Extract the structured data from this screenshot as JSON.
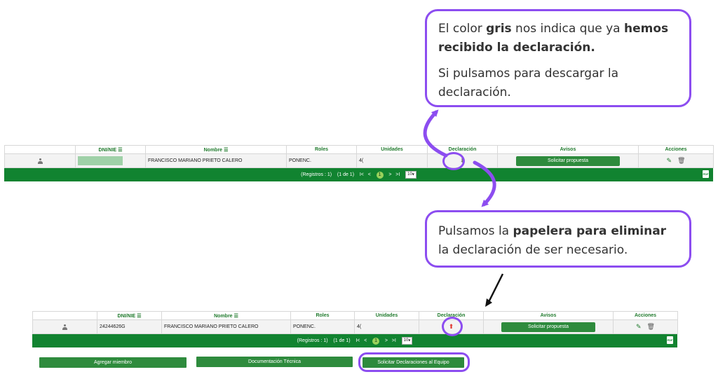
{
  "callout_top": {
    "t1": "El color ",
    "b1": "gris",
    "t2": " nos indica que ya ",
    "b2": "hemos recibido la declaración.",
    "p2": "Si pulsamos para descargar la declaración."
  },
  "callout_bottom": {
    "t1": "Pulsamos la ",
    "b1": "papelera para eliminar",
    "t2": " la declaración de ser necesario."
  },
  "table_headers": {
    "dni": "DNI/NIE",
    "nombre": "Nombre",
    "roles": "Roles",
    "unidades": "Unidades",
    "declaracion": "Declaración",
    "avisos": "Avisos",
    "acciones": "Acciones"
  },
  "top_table": {
    "row": {
      "dni": "",
      "nombre": "FRANCISCO MARIANO PRIETO CALERO",
      "roles": "PONENC.",
      "unidades": "4(",
      "declaracion_status": "received",
      "aviso_button": "Solicitar propuesta"
    },
    "pager": {
      "registros": "(Registros : 1)",
      "page_info": "(1 de 1)",
      "first": "I<",
      "prev": "<",
      "current": "1",
      "next": ">",
      "last": ">I",
      "per_page": "10"
    }
  },
  "bottom_table": {
    "row": {
      "dni": "24244626G",
      "nombre": "FRANCISCO MARIANO PRIETO CALERO",
      "roles": "PONENC.",
      "unidades": "4(",
      "declaracion_status": "pending",
      "aviso_button": "Solicitar propuesta"
    },
    "pager": {
      "registros": "(Registros : 1)",
      "page_info": "(1 de 1)",
      "first": "I<",
      "prev": "<",
      "current": "1",
      "next": ">",
      "last": ">I",
      "per_page": "10"
    }
  },
  "buttons": {
    "agregar": "Agregar miembro",
    "documentacion": "Documentación Técnica",
    "solicitar_declaraciones": "Solicitar Declaraciones al Equipo"
  },
  "icons": {
    "pdf": "PDF",
    "declaration_received": "download-icon (grey)",
    "declaration_pending": "upload-icon (red)"
  },
  "colors": {
    "accent_purple": "#8c4df0",
    "pager_green": "#118330",
    "button_green": "#2e8b3d",
    "received_grey": "#777777",
    "pending_red": "#e0322a"
  }
}
